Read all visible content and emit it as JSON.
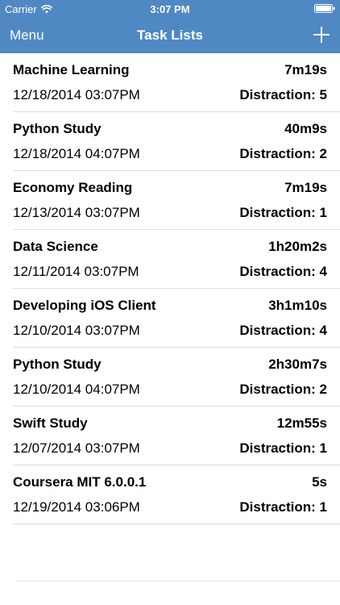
{
  "status_bar": {
    "carrier": "Carrier",
    "time": "3:07 PM"
  },
  "nav": {
    "menu_label": "Menu",
    "title": "Task Lists"
  },
  "colors": {
    "header_bg": "#5088c3",
    "text": "#000000"
  },
  "icons": [
    "wifi-icon",
    "battery-icon",
    "add-icon"
  ],
  "tasks": [
    {
      "name": "Machine Learning",
      "duration": "7m19s",
      "date": "12/18/2014 03:07PM",
      "distraction": "Distraction: 5"
    },
    {
      "name": "Python Study",
      "duration": "40m9s",
      "date": "12/18/2014 04:07PM",
      "distraction": "Distraction: 2"
    },
    {
      "name": "Economy Reading",
      "duration": "7m19s",
      "date": "12/13/2014 03:07PM",
      "distraction": "Distraction: 1"
    },
    {
      "name": "Data Science",
      "duration": "1h20m2s",
      "date": "12/11/2014 03:07PM",
      "distraction": "Distraction: 4"
    },
    {
      "name": "Developing iOS Client",
      "duration": "3h1m10s",
      "date": "12/10/2014 03:07PM",
      "distraction": "Distraction: 4"
    },
    {
      "name": "Python Study",
      "duration": "2h30m7s",
      "date": "12/10/2014 04:07PM",
      "distraction": "Distraction: 2"
    },
    {
      "name": "Swift Study",
      "duration": "12m55s",
      "date": "12/07/2014 03:07PM",
      "distraction": "Distraction: 1"
    },
    {
      "name": "Coursera MIT 6.0.0.1",
      "duration": "5s",
      "date": "12/19/2014 03:06PM",
      "distraction": "Distraction: 1"
    }
  ]
}
